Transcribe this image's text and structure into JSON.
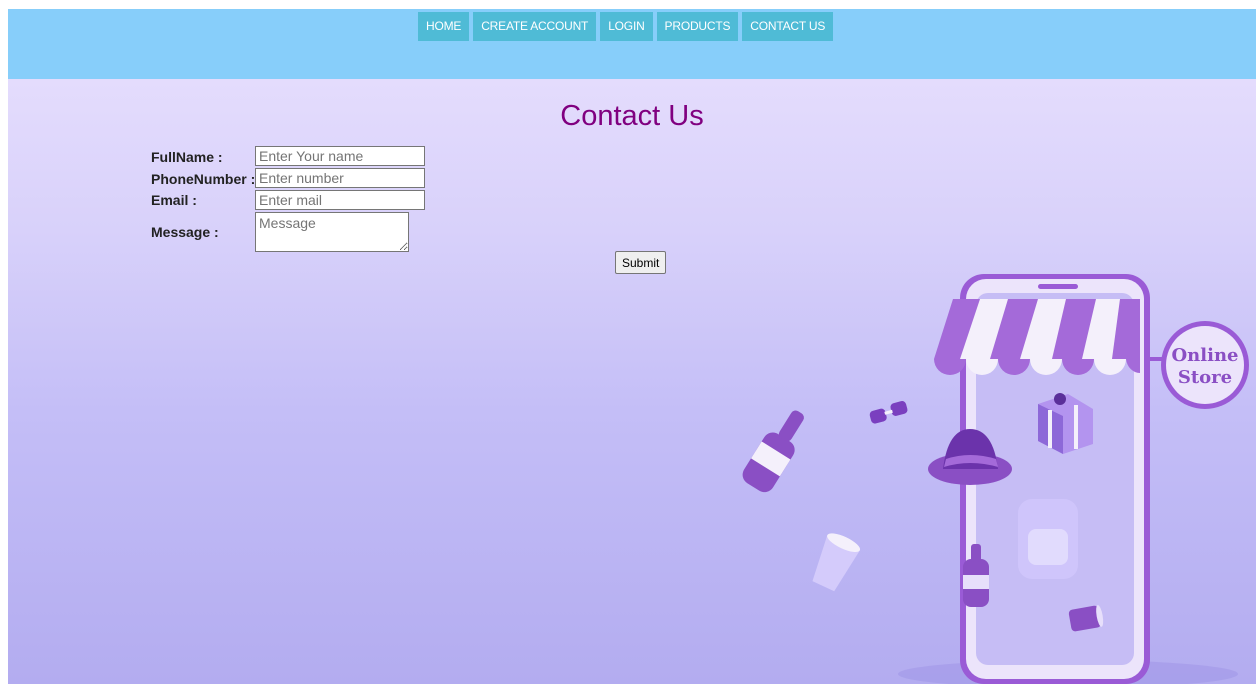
{
  "nav": {
    "items": [
      {
        "label": "HOME"
      },
      {
        "label": "CREATE ACCOUNT"
      },
      {
        "label": "LOGIN"
      },
      {
        "label": "PRODUCTS"
      },
      {
        "label": "CONTACT US"
      }
    ]
  },
  "page": {
    "title": "Contact Us"
  },
  "form": {
    "fullname_label": "FullName :",
    "fullname_placeholder": "Enter Your name",
    "fullname_value": "",
    "phone_label": "PhoneNumber :",
    "phone_placeholder": "Enter number",
    "phone_value": "",
    "email_label": "Email :",
    "email_placeholder": "Enter mail",
    "email_value": "",
    "message_label": "Message :",
    "message_placeholder": "Message",
    "message_value": "",
    "submit_label": "Submit"
  },
  "illustration": {
    "sign_line1": "Online",
    "sign_line2": "Store",
    "colors": {
      "purple_dark": "#8a4fc4",
      "purple_mid": "#a46ad9",
      "purple_light": "#c9a8ef",
      "awning_white": "#f4f0fb",
      "phone_frame": "#e9e1fa"
    }
  },
  "colors": {
    "topbar": "#87cefa",
    "nav_button": "#4fbbd6",
    "title": "#800080"
  }
}
